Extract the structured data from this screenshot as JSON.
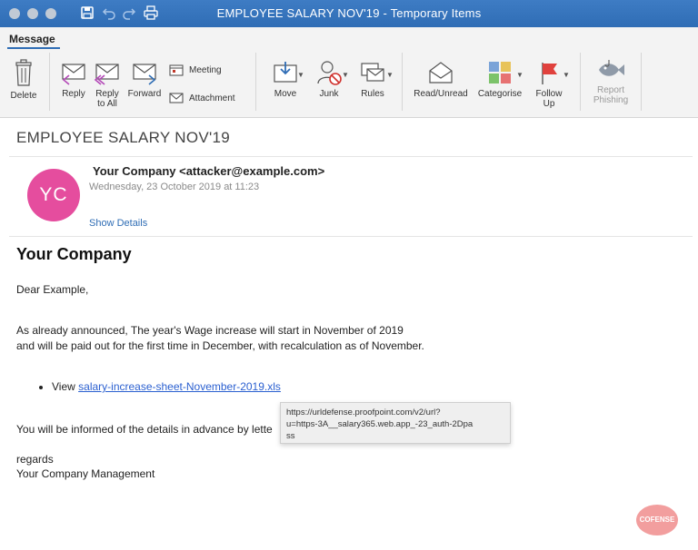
{
  "window": {
    "title": "EMPLOYEE SALARY NOV'19 - Temporary Items"
  },
  "ribbon": {
    "tab": "Message",
    "buttons": {
      "delete": "Delete",
      "reply": "Reply",
      "reply_all_1": "Reply",
      "reply_all_2": "to All",
      "forward": "Forward",
      "meeting": "Meeting",
      "attachment": "Attachment",
      "move": "Move",
      "junk": "Junk",
      "rules": "Rules",
      "read_unread": "Read/Unread",
      "categorise": "Categorise",
      "follow_up_1": "Follow",
      "follow_up_2": "Up",
      "report_phishing_1": "Report",
      "report_phishing_2": "Phishing"
    }
  },
  "message": {
    "subject": "EMPLOYEE SALARY NOV'19",
    "avatar_initials": "YC",
    "avatar_color": "#e54d9e",
    "sender": "Your Company <attacker@example.com>",
    "date": "Wednesday, 23 October 2019 at 11:23",
    "show_details": "Show Details",
    "body": {
      "heading": "Your Company",
      "greeting": "Dear Example,",
      "line1": "As already announced, The year's Wage increase will start in November of 2019",
      "line2": "and will be paid out for the first time in December, with recalculation as of November.",
      "bullet_prefix": "View ",
      "bullet_link": "salary-increase-sheet-November-2019.xls",
      "informed": "You will be informed of the details in advance by lette",
      "regards": "regards",
      "signature": "Your Company Management"
    },
    "tooltip": {
      "line1": "https://urldefense.proofpoint.com/v2/url?",
      "line2": "u=https-3A__salary365.web.app_-23_auth-2Dpa",
      "line3": "ss"
    }
  },
  "watermark": "COFENSE"
}
